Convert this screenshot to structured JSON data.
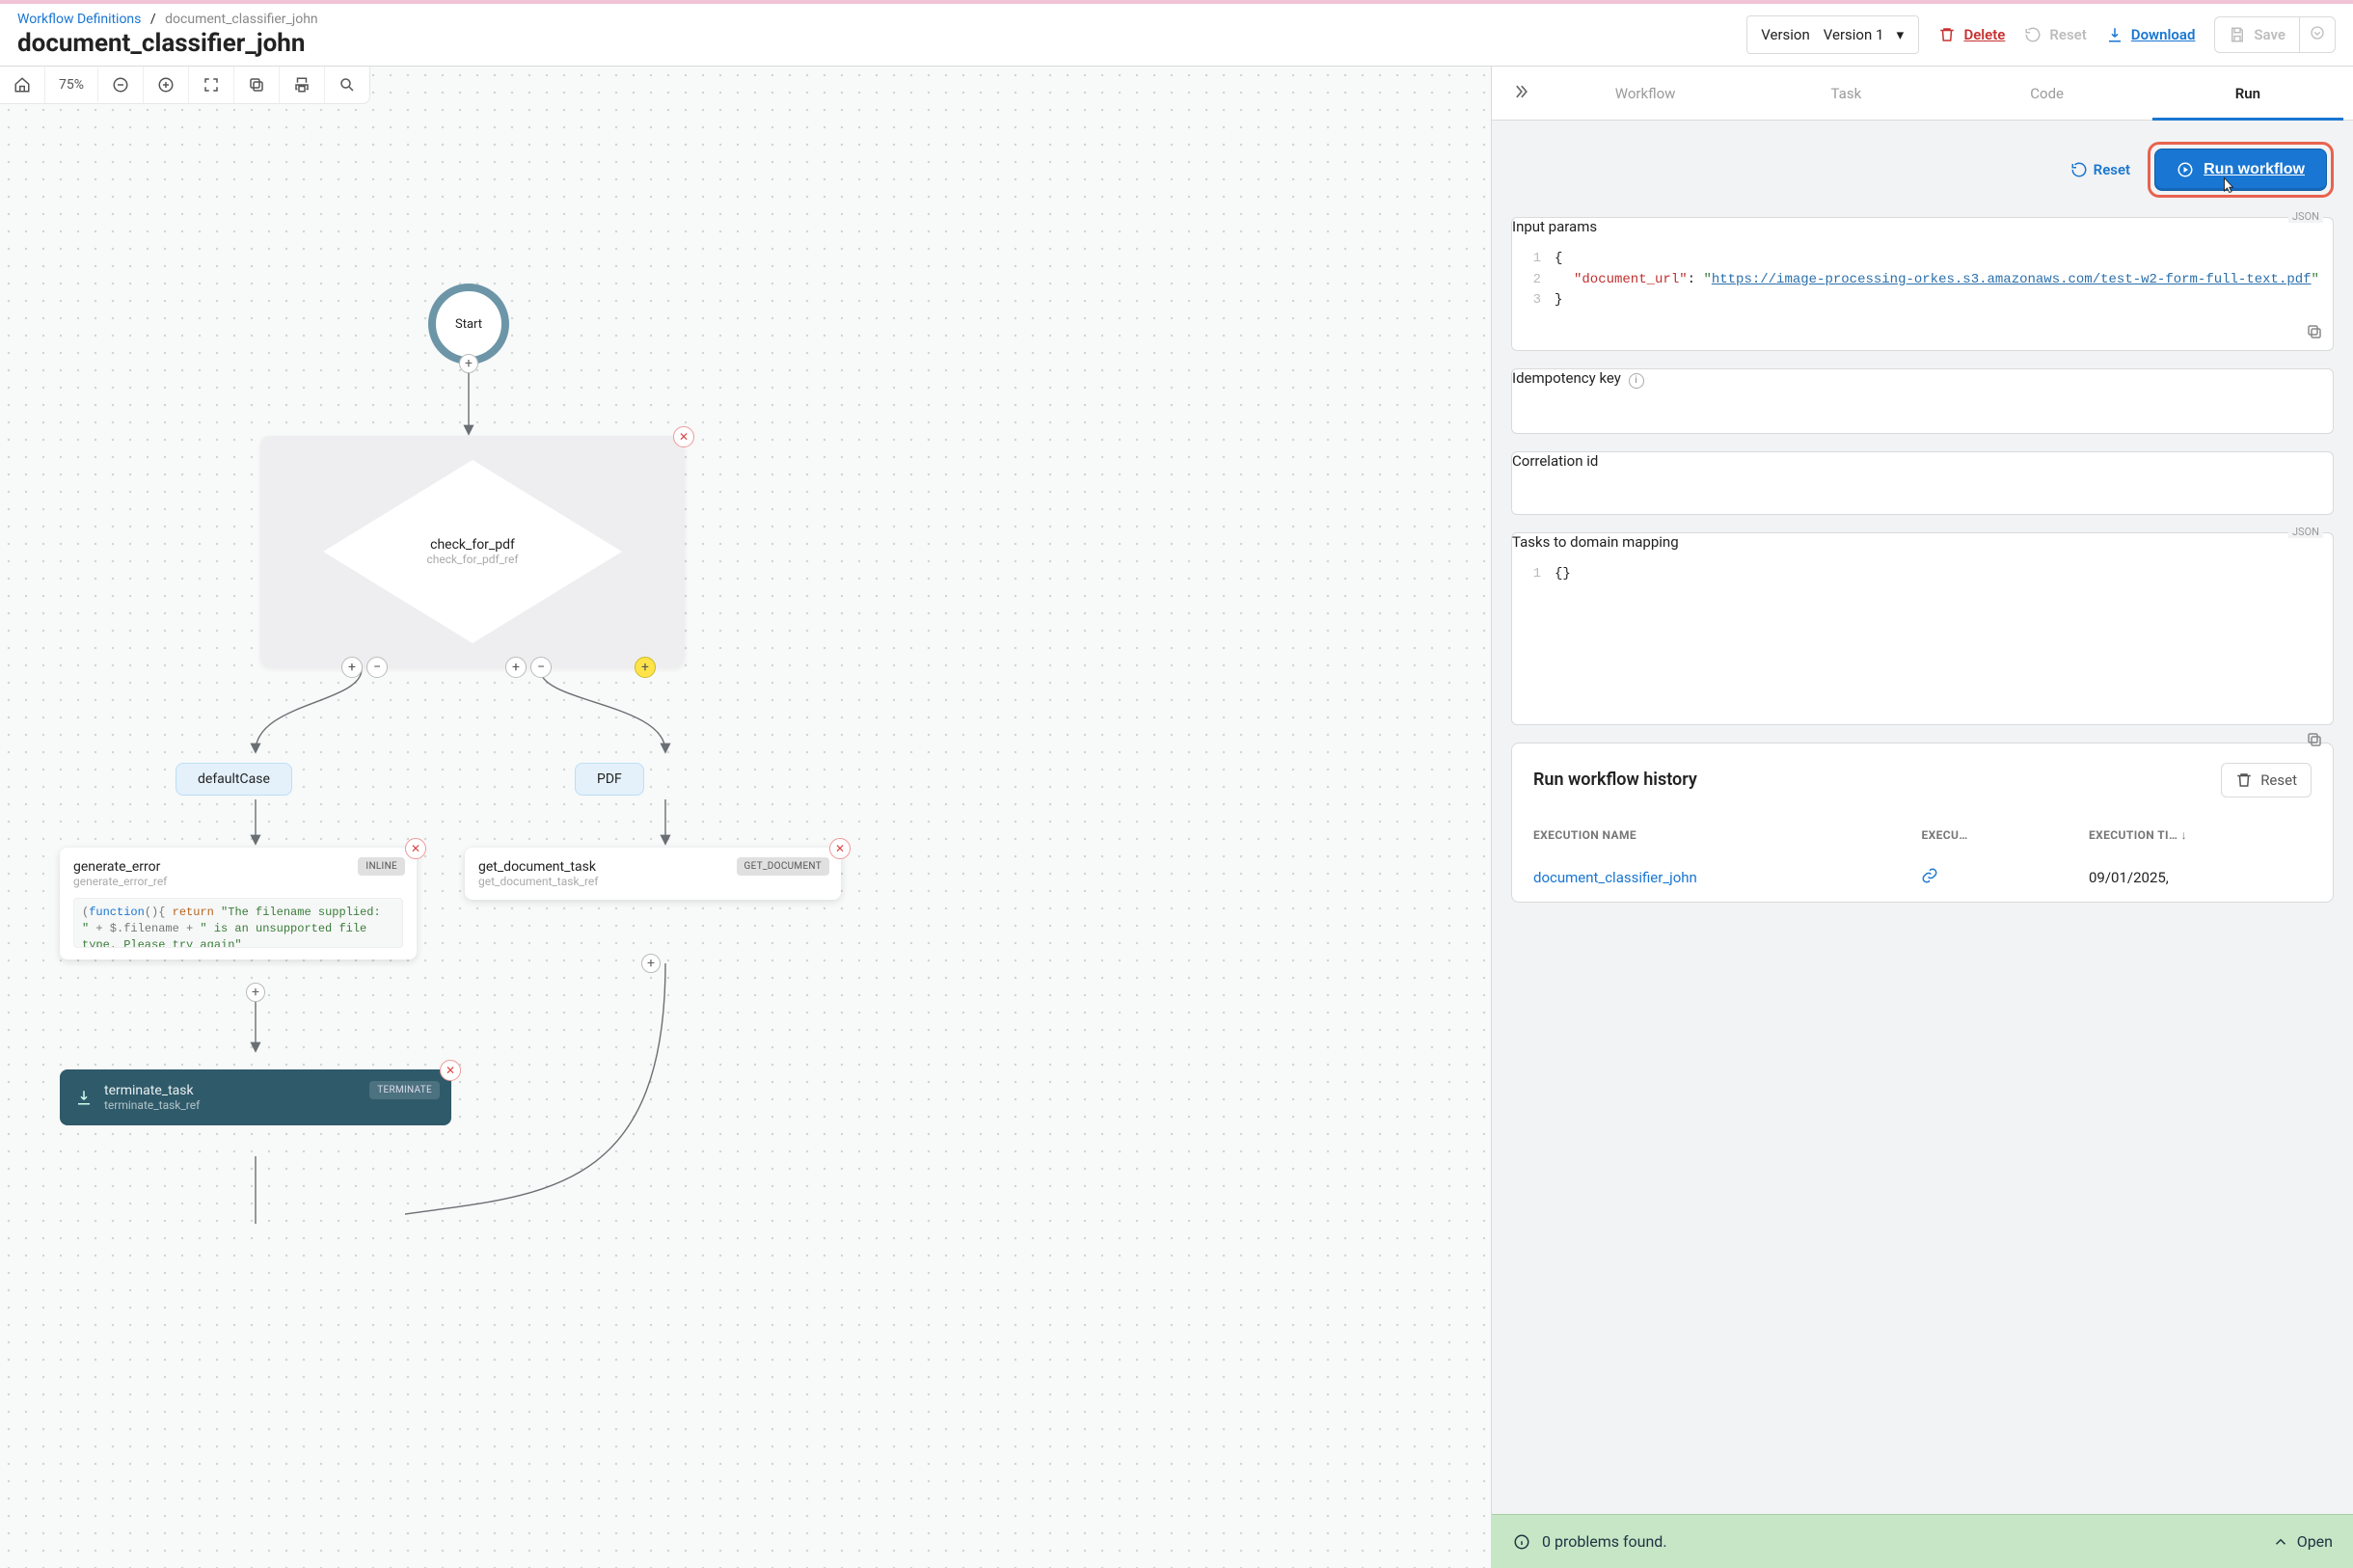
{
  "breadcrumb": {
    "root": "Workflow Definitions",
    "current": "document_classifier_john"
  },
  "page_title": "document_classifier_john",
  "version": {
    "legend": "Version",
    "value": "Version 1"
  },
  "header_actions": {
    "delete": "Delete",
    "reset": "Reset",
    "download": "Download",
    "save": "Save"
  },
  "canvas": {
    "zoom": "75%",
    "start": "Start",
    "switch": {
      "name": "check_for_pdf",
      "ref": "check_for_pdf_ref"
    },
    "branch_default": "defaultCase",
    "branch_pdf": "PDF",
    "task_error": {
      "name": "generate_error",
      "ref": "generate_error_ref",
      "chip": "INLINE",
      "code_pre": "(",
      "code_fn": "function",
      "code_open": "(){ ",
      "code_ret": "return ",
      "code_str1": "\"The filename supplied: \"",
      "code_plus1": " + $.filename + ",
      "code_str2": "\" is an unsupported file type. Please try again\""
    },
    "task_getdoc": {
      "name": "get_document_task",
      "ref": "get_document_task_ref",
      "chip": "GET_DOCUMENT"
    },
    "task_terminate": {
      "name": "terminate_task",
      "ref": "terminate_task_ref",
      "chip": "TERMINATE"
    }
  },
  "tabs": {
    "workflow": "Workflow",
    "task": "Task",
    "code": "Code",
    "run": "Run"
  },
  "panel": {
    "reset": "Reset",
    "run_btn": "Run workflow",
    "input_params": {
      "legend": "Input params",
      "json_tag": "JSON",
      "key": "\"document_url\"",
      "url": "https://image-processing-orkes.s3.amazonaws.com/test-w2-form-full-text.pdf"
    },
    "idempotency": {
      "legend": "Idempotency key"
    },
    "correlation": {
      "legend": "Correlation id"
    },
    "domain_map": {
      "legend": "Tasks to domain mapping",
      "json_tag": "JSON",
      "value": "{}"
    }
  },
  "history": {
    "title": "Run workflow history",
    "reset": "Reset",
    "cols": {
      "name": "EXECUTION NAME",
      "exec": "EXECU…",
      "time": "EXECUTION TI…"
    },
    "row": {
      "name": "document_classifier_john",
      "time": "09/01/2025,"
    }
  },
  "status": {
    "msg": "0 problems found.",
    "open": "Open"
  }
}
